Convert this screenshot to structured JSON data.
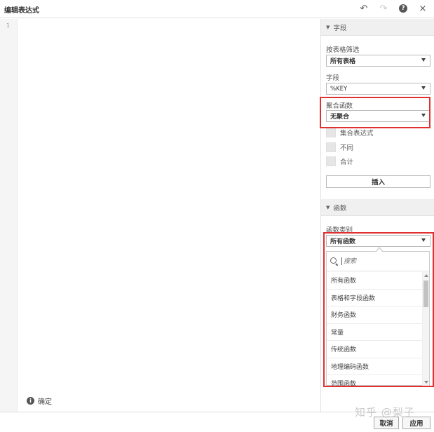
{
  "window": {
    "title": "编辑表达式",
    "icons": [
      "undo-icon",
      "redo-icon",
      "help-icon",
      "close-icon"
    ],
    "help_glyph": "?",
    "close_glyph": "×"
  },
  "editor": {
    "line_number": "1",
    "content": ""
  },
  "status": {
    "info_glyph": "i",
    "ok_label": "确定"
  },
  "fields_section": {
    "header": "字段",
    "table_filter_label": "按表格筛选",
    "table_filter_value": "所有表格",
    "field_label": "字段",
    "field_value": "%KEY",
    "aggregation_label": "聚合函数",
    "aggregation_value": "无聚合",
    "checkboxes": [
      {
        "label": "集合表达式",
        "checked": false
      },
      {
        "label": "不同",
        "checked": false
      },
      {
        "label": "合计",
        "checked": false
      }
    ],
    "insert_label": "插入"
  },
  "functions_section": {
    "header": "函数",
    "category_label": "函数类别",
    "category_value": "所有函数",
    "search_placeholder": "搜索",
    "options": [
      "所有函数",
      "表格和字段函数",
      "财务函数",
      "常量",
      "传统函数",
      "地理编码函数",
      "范围函数"
    ]
  },
  "footer": {
    "cancel_label": "取消",
    "apply_label": "应用"
  },
  "watermark": "知乎 @梨子",
  "colors": {
    "highlight": "#e03030",
    "panel_header": "#f0f0f0"
  }
}
